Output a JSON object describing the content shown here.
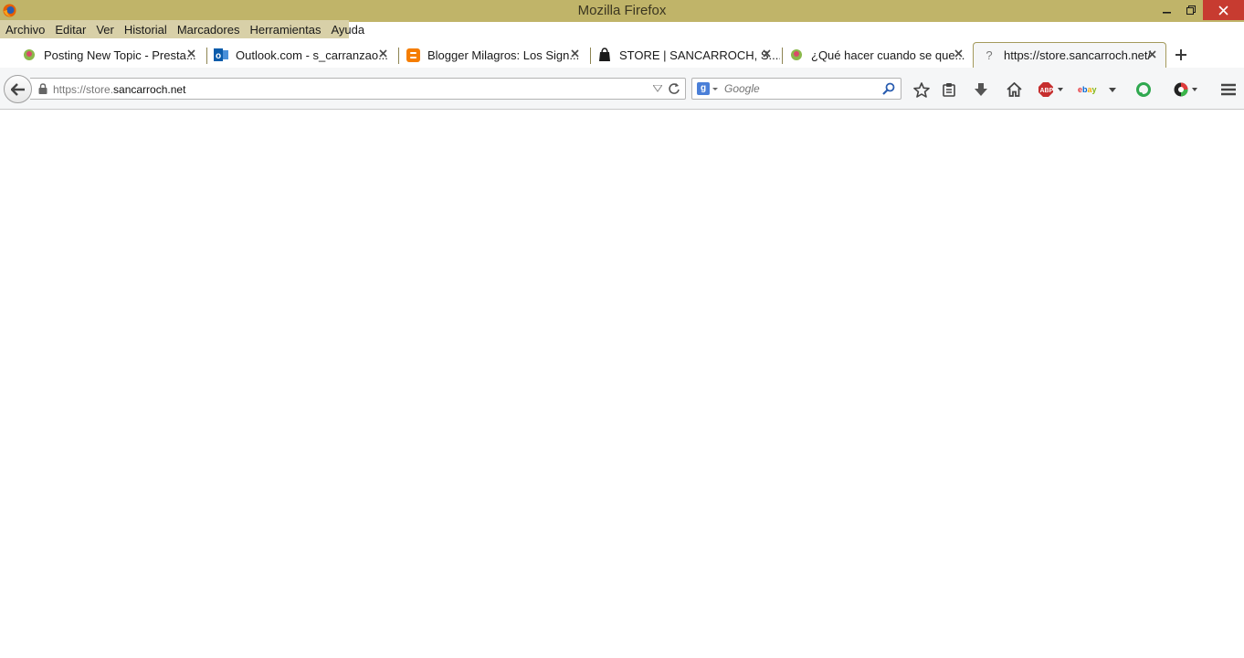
{
  "window": {
    "title": "Mozilla Firefox"
  },
  "menu": {
    "items": [
      {
        "label": "Archivo"
      },
      {
        "label": "Editar"
      },
      {
        "label": "Ver"
      },
      {
        "label": "Historial"
      },
      {
        "label": "Marcadores"
      },
      {
        "label": "Herramientas"
      },
      {
        "label": "Ayuda"
      }
    ]
  },
  "tabs": [
    {
      "label": "Posting New Topic - Presta...",
      "icon": "prestashop-icon"
    },
    {
      "label": "Outlook.com - s_carranzao...",
      "icon": "outlook-icon"
    },
    {
      "label": "Blogger Milagros: Los Sign...",
      "icon": "blogger-icon"
    },
    {
      "label": "STORE | SANCARROCH, S....",
      "icon": "store-bag-icon"
    },
    {
      "label": "¿Qué hacer cuando se que...",
      "icon": "prestashop-icon"
    },
    {
      "label": "https://store.sancarroch.net/",
      "icon": "question-icon",
      "active": true
    }
  ],
  "navbar": {
    "url_prefix": "https://store.",
    "url_domain": "sancarroch.net",
    "search_placeholder": "Google"
  },
  "colors": {
    "titlebar": "#c0b469",
    "close_button": "#c73b30",
    "toolbar": "#f5f6f7"
  }
}
